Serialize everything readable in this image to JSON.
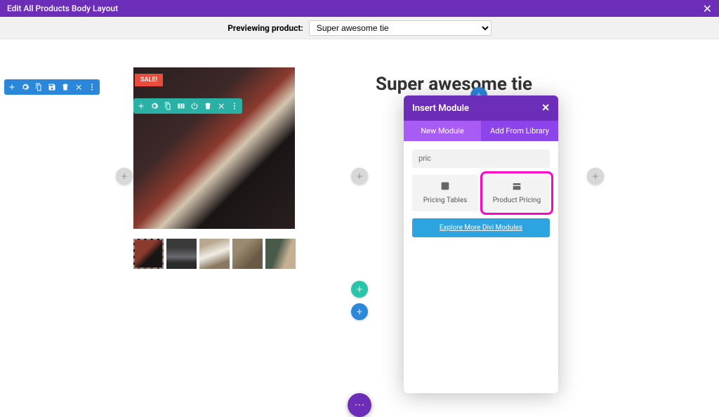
{
  "titlebar": {
    "title": "Edit All Products Body Layout"
  },
  "preview": {
    "label": "Previewing product:",
    "selected": "Super awesome tie"
  },
  "product": {
    "title": "Super awesome tie",
    "sale_tag": "SALE!"
  },
  "modal": {
    "title": "Insert Module",
    "tabs": {
      "new": "New Module",
      "lib": "Add From Library"
    },
    "search": "pric",
    "modules": {
      "pricing_tables": "Pricing Tables",
      "product_pricing": "Product Pricing"
    },
    "explore": "Explore More Divi Modules"
  }
}
